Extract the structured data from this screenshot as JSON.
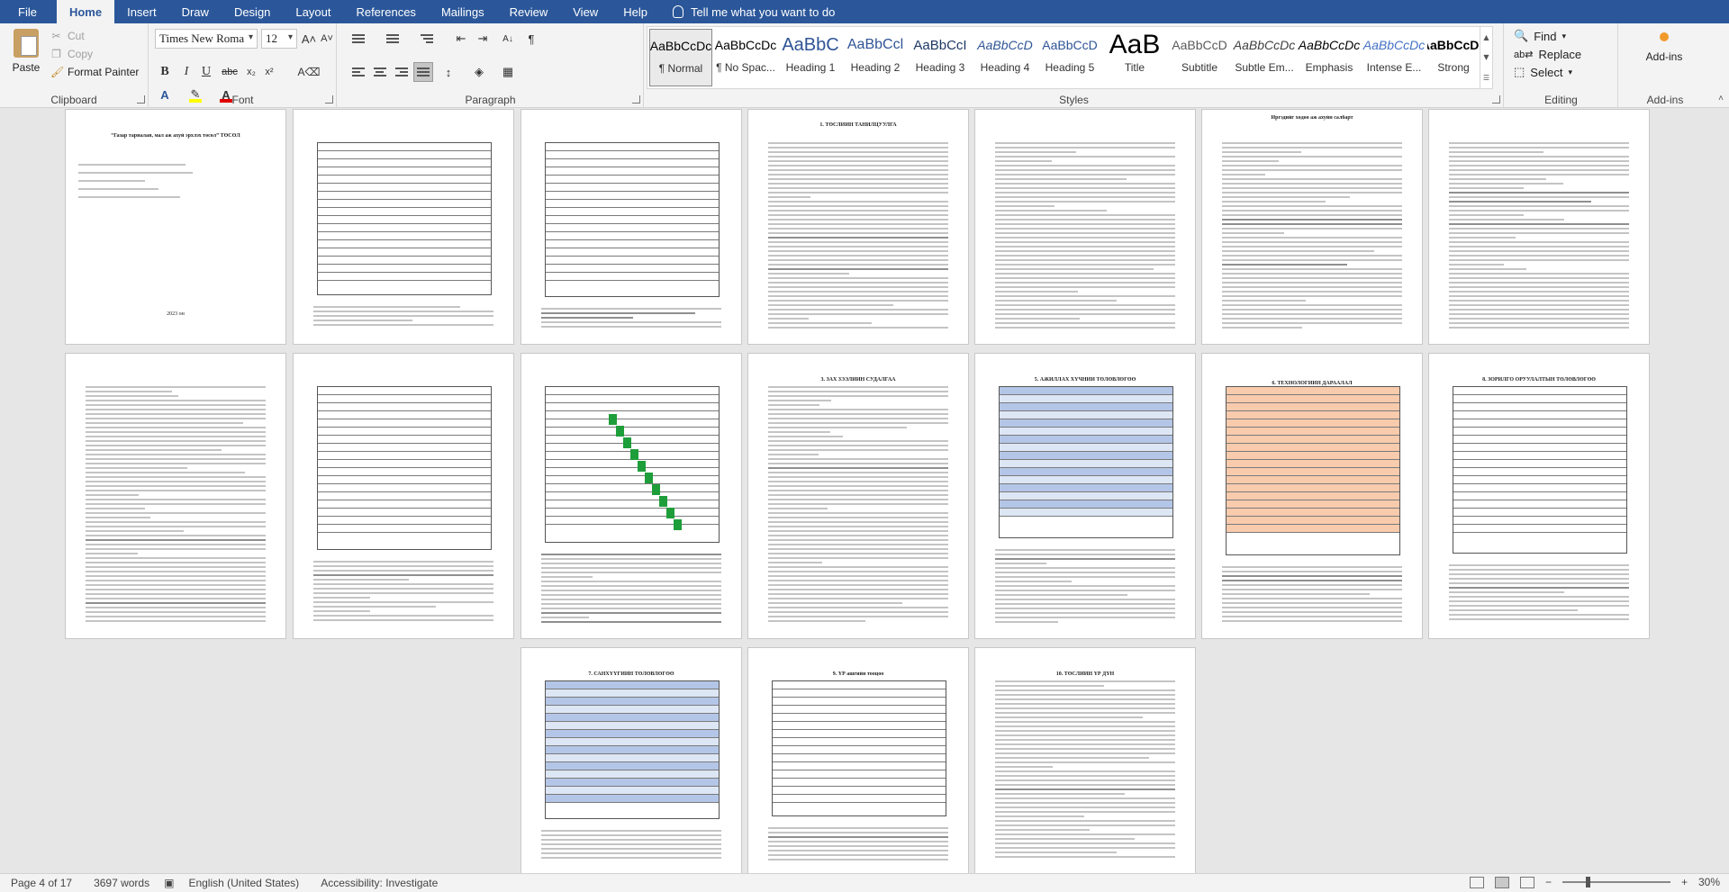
{
  "menu": {
    "tabs": [
      "File",
      "Home",
      "Insert",
      "Draw",
      "Design",
      "Layout",
      "References",
      "Mailings",
      "Review",
      "View",
      "Help"
    ],
    "active": "Home",
    "tell_me": "Tell me what you want to do"
  },
  "ribbon": {
    "clipboard": {
      "label": "Clipboard",
      "paste": "Paste",
      "cut": "Cut",
      "copy": "Copy",
      "format_painter": "Format Painter"
    },
    "font": {
      "label": "Font",
      "font_name": "Times New Roma",
      "font_size": "12"
    },
    "paragraph": {
      "label": "Paragraph"
    },
    "styles": {
      "label": "Styles",
      "items": [
        {
          "preview": "AaBbCcDc",
          "name": "¶ Normal"
        },
        {
          "preview": "AaBbCcDc",
          "name": "¶ No Spac..."
        },
        {
          "preview": "AaBbC",
          "name": "Heading 1"
        },
        {
          "preview": "AaBbCcl",
          "name": "Heading 2"
        },
        {
          "preview": "AaBbCcI",
          "name": "Heading 3"
        },
        {
          "preview": "AaBbCcD",
          "name": "Heading 4"
        },
        {
          "preview": "AaBbCcD",
          "name": "Heading 5"
        },
        {
          "preview": "AaB",
          "name": "Title"
        },
        {
          "preview": "AaBbCcD",
          "name": "Subtitle"
        },
        {
          "preview": "AaBbCcDc",
          "name": "Subtle Em..."
        },
        {
          "preview": "AaBbCcDc",
          "name": "Emphasis"
        },
        {
          "preview": "AaBbCcDc",
          "name": "Intense E..."
        },
        {
          "preview": "AaBbCcDc",
          "name": "Strong"
        }
      ]
    },
    "editing": {
      "label": "Editing",
      "find": "Find",
      "replace": "Replace",
      "select": "Select"
    },
    "addins": {
      "label": "Add-ins",
      "button": "Add-ins"
    }
  },
  "document": {
    "page1_title": "“Газар тариалан, мал аж ахуй эрхлэх төсөл” ТӨСӨЛ",
    "page1_year": "2023 он",
    "pages": [
      {
        "heading": "1. ТӨСЛИЙН ТАНИЛЦУУЛГА"
      },
      {
        "heading": "Иргэдийг хөдөө аж ахуйн салбарт"
      },
      {
        "heading": "3. ЗАХ ЗЭЭЛИЙН СУДАЛГАА"
      },
      {
        "heading": "5. АЖИЛЛАХ ХҮЧНИЙ ТӨЛӨВЛӨГӨӨ"
      },
      {
        "heading": "6. ТЕХНОЛОГИЙН ДАРААЛАЛ"
      },
      {
        "heading": "8. ЗОРИЛГО ОРУУЛАЛТЫН ТӨЛӨВЛӨГӨӨ"
      },
      {
        "heading": "7. САНХҮҮГИЙН ТӨЛӨВЛӨГӨӨ"
      },
      {
        "heading": "9. ҮР ашгийн тооцоо"
      },
      {
        "heading": "10. ТӨСЛИЙН ҮР ДҮН"
      }
    ]
  },
  "status": {
    "page": "Page 4 of 17",
    "words": "3697 words",
    "language": "English (United States)",
    "accessibility": "Accessibility: Investigate",
    "zoom": "30%"
  },
  "colors": {
    "brand": "#2b579a",
    "gantt_green": "#1e9e3a",
    "table_blue": "#b4c6e7",
    "table_orange": "#f8cbad"
  }
}
